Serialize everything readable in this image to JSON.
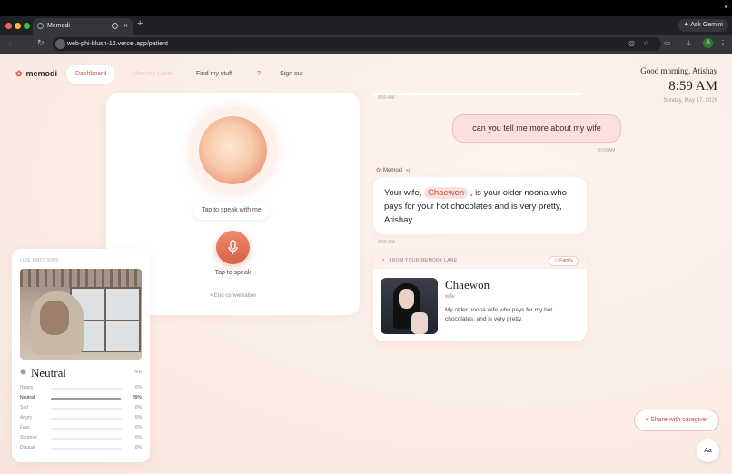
{
  "browser": {
    "tab_title": "Memodi",
    "url": "web-phi-blush-12.vercel.app/patient",
    "ask_gemini": "Ask Gemini",
    "avatar_letter": "A"
  },
  "nav": {
    "logo": "memodi",
    "dashboard": "Dashboard",
    "memory_lane": "Memory Lane",
    "find": "Find my stuff",
    "help": "?",
    "signout": "Sign out"
  },
  "header": {
    "greeting": "Good morning, Atishay",
    "time": "8:59 AM",
    "date": "Sunday, May 17, 2026"
  },
  "voice": {
    "prompt": "Tap to speak with me",
    "tap": "Tap to speak",
    "end": "× End conversation"
  },
  "emotions": {
    "label": "LIVE EMOTIONS",
    "current": "Neutral",
    "live": "live",
    "rows": [
      {
        "name": "Happy",
        "value": 0,
        "pct": "0%"
      },
      {
        "name": "Neutral",
        "value": 99,
        "pct": "99%"
      },
      {
        "name": "Sad",
        "value": 0,
        "pct": "0%"
      },
      {
        "name": "Angry",
        "value": 0,
        "pct": "0%"
      },
      {
        "name": "Fear",
        "value": 0,
        "pct": "0%"
      },
      {
        "name": "Surprise",
        "value": 0,
        "pct": "0%"
      },
      {
        "name": "Disgust",
        "value": 0,
        "pct": "0%"
      }
    ]
  },
  "chat": {
    "stamp_top": "8:59 AM",
    "user_message": "can you tell me more about my wife",
    "user_stamp": "8:59 AM",
    "assistant_name": "Memodi",
    "reply_pre": "Your wife, ",
    "reply_name": "Chaewon",
    "reply_post": " , is your older noona who pays for your hot chocolates and is very pretty, Atishay.",
    "reply_stamp": "8:59 AM"
  },
  "memory": {
    "header": "FROM YOUR MEMORY LANE",
    "tag": "Family",
    "name": "Chaewon",
    "relation": "wife",
    "description": "My older noona wife who pays for my hot chocolates, and is very pretty."
  },
  "share": "+ Share with caregiver",
  "text_size": "Aa"
}
